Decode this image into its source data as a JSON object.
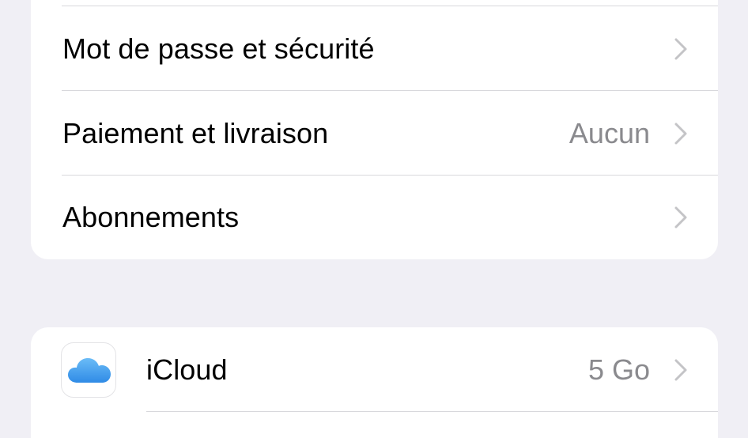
{
  "colors": {
    "background": "#f0eff5",
    "card": "#ffffff",
    "label": "#000000",
    "value": "#8a8a8e",
    "separator": "#d8d8dc",
    "chevron": "#c4c4c7",
    "icloud_blue": "#3d9cf0"
  },
  "account_group": {
    "rows": [
      {
        "label": "Mot de passe et sécurité",
        "value": "",
        "icon": "chevron-right-icon"
      },
      {
        "label": "Paiement et livraison",
        "value": "Aucun",
        "icon": "chevron-right-icon"
      },
      {
        "label": "Abonnements",
        "value": "",
        "icon": "chevron-right-icon"
      }
    ]
  },
  "services_group": {
    "rows": [
      {
        "label": "iCloud",
        "value": "5 Go",
        "app_icon": "icloud-icon",
        "icon": "chevron-right-icon"
      }
    ]
  }
}
